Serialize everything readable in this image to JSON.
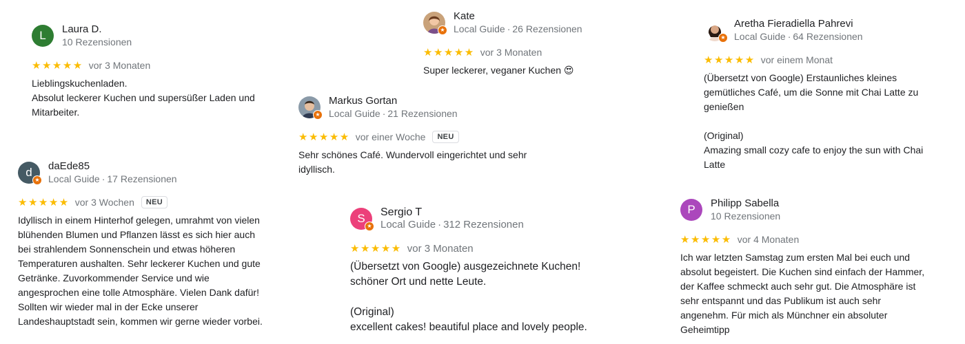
{
  "reviews": [
    {
      "name": "Laura D.",
      "meta": "10 Rezensionen",
      "initial": "L",
      "avatar_color": "#2e7d32",
      "stars": "★★★★★",
      "when": "vor 3 Monaten",
      "text": "Lieblingskuchenladen.\nAbsolut leckerer Kuchen und supersüßer Laden und Mitarbeiter."
    },
    {
      "name": "daEde85",
      "guide": "Local Guide",
      "meta": "17 Rezensionen",
      "initial": "d",
      "avatar_color": "#455a64",
      "stars": "★★★★★",
      "when": "vor 3 Wochen",
      "badge": "NEU",
      "text": "Idyllisch in einem Hinterhof gelegen, umrahmt von vielen blühenden Blumen und Pflanzen lässt es sich hier auch bei strahlendem Sonnenschein und etwas höheren Temperaturen aushalten. Sehr leckerer Kuchen und gute Getränke. Zuvorkommender Service und wie angesprochen eine tolle Atmosphäre. Vielen Dank dafür! Sollten wir wieder mal in der Ecke unserer Landeshauptstadt sein, kommen wir gerne wieder vorbei."
    },
    {
      "name": "Kate",
      "guide": "Local Guide",
      "meta": "26 Rezensionen",
      "stars": "★★★★★",
      "when": "vor 3 Monaten",
      "text": "Super leckerer, veganer Kuchen 😍"
    },
    {
      "name": "Markus Gortan",
      "guide": "Local Guide",
      "meta": "21 Rezensionen",
      "stars": "★★★★★",
      "when": "vor einer Woche",
      "badge": "NEU",
      "text": "Sehr schönes Café. Wundervoll eingerichtet und sehr idyllisch."
    },
    {
      "name": "Sergio T",
      "guide": "Local Guide",
      "meta": "312 Rezensionen",
      "initial": "S",
      "avatar_color": "#ec407a",
      "stars": "★★★★★",
      "when": "vor 3 Monaten",
      "text": "(Übersetzt von Google) ausgezeichnete Kuchen!\nschöner Ort und nette Leute.\n\n(Original)\nexcellent cakes! beautiful place and lovely people."
    },
    {
      "name": "Aretha Fieradiella Pahrevi",
      "guide": "Local Guide",
      "meta": "64 Rezensionen",
      "stars": "★★★★★",
      "when": "vor einem Monat",
      "text": "(Übersetzt von Google) Erstaunliches kleines gemütliches Café, um die Sonne mit Chai Latte zu genießen\n\n(Original)\nAmazing small cozy cafe to enjoy the sun with Chai Latte"
    },
    {
      "name": "Philipp Sabella",
      "meta": "10 Rezensionen",
      "initial": "P",
      "avatar_color": "#ab47bc",
      "stars": "★★★★★",
      "when": "vor 4 Monaten",
      "text": "Ich war letzten Samstag zum ersten Mal bei euch und absolut begeistert. Die Kuchen sind einfach der Hammer, der Kaffee schmeckt auch sehr gut. Die Atmosphäre ist sehr entspannt und das Publikum ist auch sehr angenehm. Für mich als Münchner ein absoluter Geheimtipp"
    }
  ]
}
